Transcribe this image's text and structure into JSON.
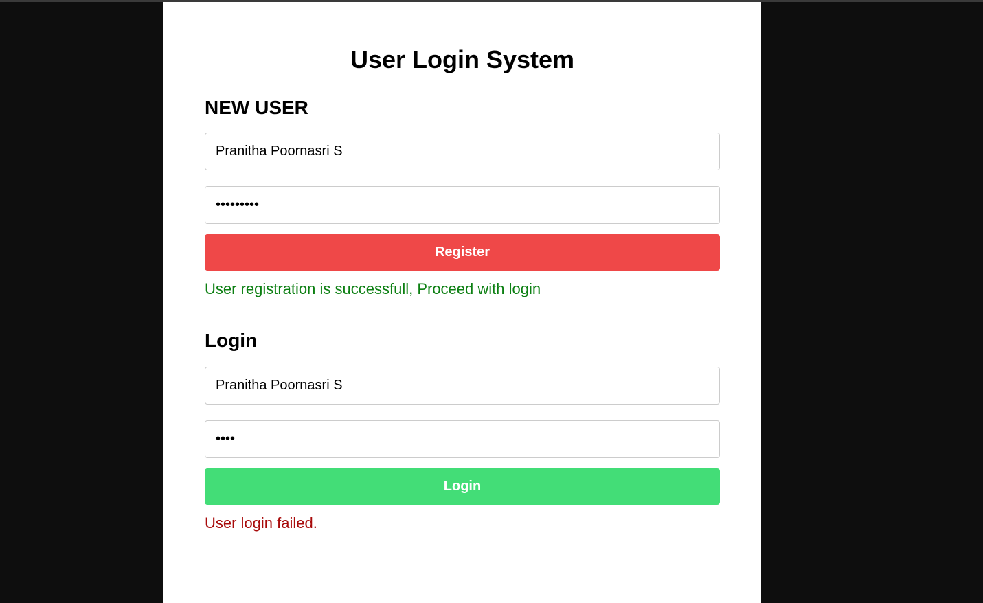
{
  "title": "User Login System",
  "register": {
    "heading": "NEW USER",
    "username_value": "Pranitha Poornasri S",
    "password_value": "•••••••••",
    "button_label": "Register",
    "message": "User registration is successfull, Proceed with login"
  },
  "login": {
    "heading": "Login",
    "username_value": "Pranitha Poornasri S",
    "password_value": "••••",
    "button_label": "Login",
    "message": "User login failed."
  },
  "colors": {
    "register_button": "#ef4848",
    "login_button": "#43dd77",
    "success_text": "#0c7f12",
    "error_text": "#a80b0b",
    "backdrop": "#0e0e0e"
  }
}
